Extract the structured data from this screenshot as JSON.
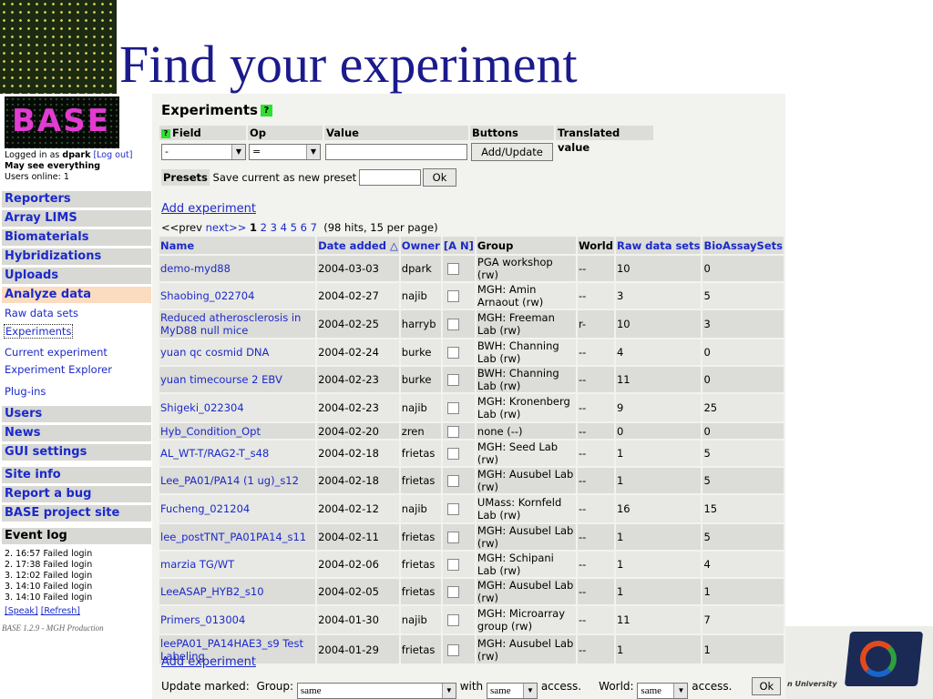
{
  "slide": {
    "title": "Find your experiment"
  },
  "logo": {
    "text": "BASE"
  },
  "user": {
    "logged_in_prefix": "Logged in as",
    "username": "dpark",
    "logout_label": "[Log out]",
    "permission": "May see everything",
    "online": "Users online: 1"
  },
  "nav": {
    "reporters": "Reporters",
    "array_lims": "Array LIMS",
    "biomaterials": "Biomaterials",
    "hybridizations": "Hybridizations",
    "uploads": "Uploads",
    "analyze_data": "Analyze data",
    "raw_data_sets": "Raw data sets",
    "experiments": "Experiments",
    "current_experiment": "Current experiment",
    "experiment_explorer": "Experiment Explorer",
    "plugins": "Plug-ins",
    "users": "Users",
    "news": "News",
    "gui_settings": "GUI settings",
    "site_info": "Site info",
    "report_bug": "Report a bug",
    "base_project": "BASE project site",
    "event_log": "Event log"
  },
  "event_log": {
    "entries": [
      "2. 16:57 Failed login",
      "2. 17:38 Failed login",
      "3. 12:02 Failed login",
      "3. 14:10 Failed login",
      "3. 14:10 Failed login"
    ],
    "speak": "[Speak]",
    "refresh": "[Refresh]"
  },
  "version": "BASE 1.2.9 - MGH Production",
  "filter": {
    "heading": "Experiments",
    "help_icon": "?",
    "field_label": "Field",
    "op_label": "Op",
    "value_label": "Value",
    "buttons_label": "Buttons",
    "translated_label": "Translated value",
    "field_value": "-",
    "op_value": "=",
    "value_text": "",
    "add_update": "Add/Update",
    "presets_label": "Presets",
    "save_preset_label": "Save current as new preset",
    "preset_name": "",
    "ok": "Ok"
  },
  "list": {
    "add_experiment": "Add experiment",
    "prev": "<<prev",
    "next": "next>>",
    "pages": [
      "1",
      "2",
      "3",
      "4",
      "5",
      "6",
      "7"
    ],
    "current_page": "1",
    "hits": "(98 hits, 15 per page)",
    "columns": [
      "Name",
      "Date added △",
      "Owner",
      "[A N]",
      "Group",
      "World",
      "Raw data sets",
      "BioAssaySets"
    ],
    "rows": [
      {
        "name": "demo-myd88",
        "date": "2004-03-03",
        "owner": "dpark",
        "group": "PGA workshop (rw)",
        "world": "--",
        "raw": "10",
        "bio": "0"
      },
      {
        "name": "Shaobing_022704",
        "date": "2004-02-27",
        "owner": "najib",
        "group": "MGH: Amin Arnaout (rw)",
        "world": "--",
        "raw": "3",
        "bio": "5"
      },
      {
        "name": "Reduced atherosclerosis in MyD88 null mice",
        "date": "2004-02-25",
        "owner": "harryb",
        "group": "MGH: Freeman Lab (rw)",
        "world": "r-",
        "raw": "10",
        "bio": "3"
      },
      {
        "name": "yuan qc cosmid DNA",
        "date": "2004-02-24",
        "owner": "burke",
        "group": "BWH: Channing Lab (rw)",
        "world": "--",
        "raw": "4",
        "bio": "0"
      },
      {
        "name": "yuan timecourse 2 EBV",
        "date": "2004-02-23",
        "owner": "burke",
        "group": "BWH: Channing Lab (rw)",
        "world": "--",
        "raw": "11",
        "bio": "0"
      },
      {
        "name": "Shigeki_022304",
        "date": "2004-02-23",
        "owner": "najib",
        "group": "MGH: Kronenberg Lab (rw)",
        "world": "--",
        "raw": "9",
        "bio": "25"
      },
      {
        "name": "Hyb_Condition_Opt",
        "date": "2004-02-20",
        "owner": "zren",
        "group": "none (--)",
        "world": "--",
        "raw": "0",
        "bio": "0"
      },
      {
        "name": "AL_WT-T/RAG2-T_s48",
        "date": "2004-02-18",
        "owner": "frietas",
        "group": "MGH: Seed Lab (rw)",
        "world": "--",
        "raw": "1",
        "bio": "5"
      },
      {
        "name": "Lee_PA01/PA14 (1 ug)_s12",
        "date": "2004-02-18",
        "owner": "frietas",
        "group": "MGH: Ausubel Lab (rw)",
        "world": "--",
        "raw": "1",
        "bio": "5"
      },
      {
        "name": "Fucheng_021204",
        "date": "2004-02-12",
        "owner": "najib",
        "group": "UMass: Kornfeld Lab (rw)",
        "world": "--",
        "raw": "16",
        "bio": "15"
      },
      {
        "name": "lee_postTNT_PA01PA14_s11",
        "date": "2004-02-11",
        "owner": "frietas",
        "group": "MGH: Ausubel Lab (rw)",
        "world": "--",
        "raw": "1",
        "bio": "5"
      },
      {
        "name": "marzia TG/WT",
        "date": "2004-02-06",
        "owner": "frietas",
        "group": "MGH: Schipani Lab (rw)",
        "world": "--",
        "raw": "1",
        "bio": "4"
      },
      {
        "name": "LeeASAP_HYB2_s10",
        "date": "2004-02-05",
        "owner": "frietas",
        "group": "MGH: Ausubel Lab (rw)",
        "world": "--",
        "raw": "1",
        "bio": "1"
      },
      {
        "name": "Primers_013004",
        "date": "2004-01-30",
        "owner": "najib",
        "group": "MGH: Microarray group (rw)",
        "world": "--",
        "raw": "11",
        "bio": "7"
      },
      {
        "name": "leePA01_PA14HAE3_s9 Test Labeling",
        "date": "2004-01-29",
        "owner": "frietas",
        "group": "MGH: Ausubel Lab (rw)",
        "world": "--",
        "raw": "1",
        "bio": "1"
      }
    ]
  },
  "update": {
    "label": "Update marked:",
    "group_label": "Group:",
    "group_value": "same",
    "with_label": "with",
    "group_access": "same",
    "access_label": "access.",
    "world_label": "World:",
    "world_access": "same",
    "world_access_label": "access.",
    "ok": "Ok"
  },
  "corner": {
    "caption": "n University"
  },
  "colors": {
    "link": "#1b2ac9",
    "title": "#1b1a8c",
    "logo": "#e23bd2",
    "help": "#2ee02e",
    "active_nav": "#fbdcc0"
  }
}
